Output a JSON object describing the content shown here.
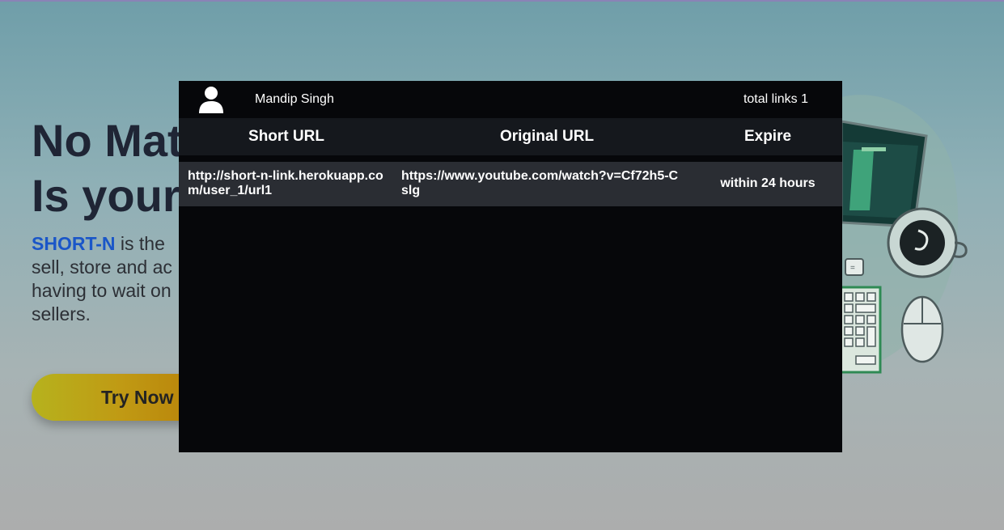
{
  "hero": {
    "title_line1": "No Mat",
    "title_line2": "Is your",
    "brand": "SHORT-N",
    "text_line1_rest": " is the",
    "text_line2": "sell, store and ac",
    "text_line3": "having to wait on",
    "text_line4": "sellers.",
    "cta_label": "Try Now"
  },
  "modal": {
    "user_name": "Mandip Singh",
    "total_links": "total links 1",
    "columns": [
      "Short URL",
      "Original URL",
      "Expire"
    ],
    "rows": [
      {
        "short_url": "http://short-n-link.herokuapp.com/user_1/url1",
        "original_url": "https://www.youtube.com/watch?v=Cf72h5-Cslg",
        "expire": "within 24 hours"
      }
    ]
  },
  "colors": {
    "brand": "#1a56c8",
    "modal_bg": "#06070a",
    "header_row_bg": "#15181d",
    "data_row_bg": "#2a2d33"
  },
  "icons": [
    "user-avatar-icon"
  ]
}
